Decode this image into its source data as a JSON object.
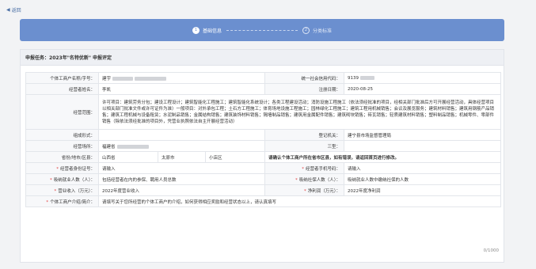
{
  "nav": {
    "back_label": "返回"
  },
  "steps": [
    {
      "num": "1",
      "label": "基础信息"
    },
    {
      "num": "2",
      "label": "分类标准"
    }
  ],
  "task": {
    "prefix": "申报任务：",
    "title": "2023年\"名特优新\" 申报评定"
  },
  "fields": {
    "name_label": "个体工商户名称/字号：",
    "name_value": "建宇",
    "credit_label": "统一社会信用代码：",
    "credit_value": "9139",
    "operator_label": "经营者姓名：",
    "operator_value": "李凯",
    "reg_date_label": "注册日期：",
    "reg_date_value": "2020-08-25",
    "scope_label": "经营范围：",
    "scope_value": "许可项目：建筑劳务分包；建设工程设计；建筑智能化工程施工；建筑智能化系统设计；各类工程建设活动；消防设施工程施工（依法须经批准的项目，经相关部门批准后方可开展经营活动，具体经营项目以相关部门批准文件或许可证件为准）一般项目：对外承包工程；土石方工程施工；体育场地设施工程施工；园林绿化工程施工；建筑工程用机械销售；会议及展览服务；建筑材料销售；建筑用钢筋产品销售；建筑工程机械与设备租赁；水泥制品销售；金属结构销售；建筑装饰材料销售；隔墙制品销售；建筑用金属配件销售；建筑砌块销售；砖瓦销售；轻质建筑材料销售；塑料制品销售；机械零件、零部件销售（除依法须经批准的项目外，凭营业执照依法自主开展经营活动）",
    "org_label": "组成形式：",
    "org_value": "",
    "authority_label": "登记机关：",
    "authority_value": "建宁县市场监督管理局",
    "address_label": "经营场所：",
    "address_value": "福建省",
    "type_label": "三型：",
    "type_value": "",
    "region_label": "省份/地市/区县：",
    "province": "山西省",
    "city": "太原市",
    "district": "小店区",
    "region_warning": "请确认个体工商户所在省市区县，如有错误，请返回首页进行修改。",
    "id_label": "经营者身份证号：",
    "id_placeholder": "请输入",
    "phone_label": "经营者手机号码：",
    "phone_placeholder": "请输入",
    "employ_label": "吸纳就业人数（人）：",
    "employ_placeholder": "包括经营者在内的参保、聘用人员总数",
    "social_label": "吸纳社保人数（人）：",
    "social_placeholder": "吸纳就业人数中缴纳社保的人数",
    "revenue_label": "营业收入（万元）：",
    "revenue_placeholder": "2022年度营业收入",
    "profit_label": "净利润（万元）：",
    "profit_placeholder": "2022年度净利润",
    "intro_label": "个体工商户介绍/简介：",
    "intro_placeholder": "请填写关于您所经营的个体工商户的介绍，如何获得相应奖励和经营状态以上，请认真填写",
    "intro_counter": "0/1000"
  }
}
